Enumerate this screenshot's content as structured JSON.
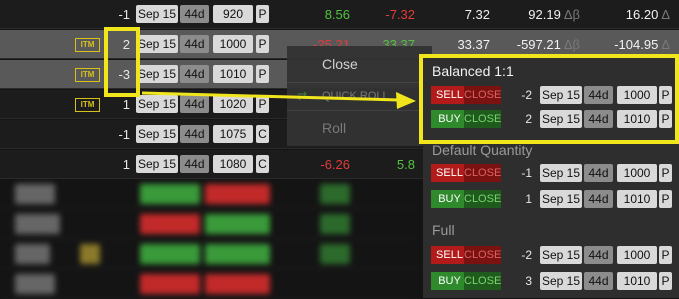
{
  "rows": [
    {
      "itm": "",
      "qty": "-1",
      "date": "Sep 15",
      "dte": "44d",
      "strike": "920",
      "type": "P",
      "c1": "8.56",
      "c2": "-7.32",
      "c3": "7.32",
      "c4": "92.19",
      "c4sym": "Δβ",
      "c5": "16.20",
      "c5sym": "Δ"
    },
    {
      "itm": "ITM",
      "qty": "2",
      "date": "Sep 15",
      "dte": "44d",
      "strike": "1000",
      "type": "P",
      "c1": "-25.21",
      "c2": "33.37",
      "c3": "33.37",
      "c4": "-597.21",
      "c4sym": "Δβ",
      "c5": "-104.95",
      "c5sym": "Δ"
    },
    {
      "itm": "ITM",
      "qty": "-3",
      "date": "Sep 15",
      "dte": "44d",
      "strike": "1010",
      "type": "P"
    },
    {
      "itm": "ITM",
      "qty": "1",
      "date": "Sep 15",
      "dte": "44d",
      "strike": "1020",
      "type": "P"
    },
    {
      "itm": "",
      "qty": "-1",
      "date": "Sep 15",
      "dte": "44d",
      "strike": "1075",
      "type": "C"
    },
    {
      "itm": "",
      "qty": "1",
      "date": "Sep 15",
      "dte": "44d",
      "strike": "1080",
      "type": "C",
      "c1": "-6.26",
      "c2": "5.8"
    }
  ],
  "context_menu": {
    "close": "Close",
    "quick_roll": "QUICK ROLL",
    "roll": "Roll"
  },
  "panel": {
    "sections": [
      {
        "title": "Balanced 1:1",
        "legs": [
          {
            "action": "SELL",
            "effect": "CLOSE",
            "qty": "-2",
            "date": "Sep 15",
            "dte": "44d",
            "strike": "1000",
            "type": "P"
          },
          {
            "action": "BUY",
            "effect": "CLOSE",
            "qty": "2",
            "date": "Sep 15",
            "dte": "44d",
            "strike": "1010",
            "type": "P"
          }
        ]
      },
      {
        "title": "Default Quantity",
        "legs": [
          {
            "action": "SELL",
            "effect": "CLOSE",
            "qty": "-1",
            "date": "Sep 15",
            "dte": "44d",
            "strike": "1000",
            "type": "P"
          },
          {
            "action": "BUY",
            "effect": "CLOSE",
            "qty": "1",
            "date": "Sep 15",
            "dte": "44d",
            "strike": "1010",
            "type": "P"
          }
        ]
      },
      {
        "title": "Full",
        "legs": [
          {
            "action": "SELL",
            "effect": "CLOSE",
            "qty": "-2",
            "date": "Sep 15",
            "dte": "44d",
            "strike": "1000",
            "type": "P"
          },
          {
            "action": "BUY",
            "effect": "CLOSE",
            "qty": "3",
            "date": "Sep 15",
            "dte": "44d",
            "strike": "1010",
            "type": "P"
          }
        ]
      }
    ]
  },
  "colors": {
    "highlight": "#f1e51c",
    "sell": "#b31b1b",
    "buy": "#2e8a2a",
    "positive": "#54c23f",
    "negative": "#e23c3c"
  }
}
